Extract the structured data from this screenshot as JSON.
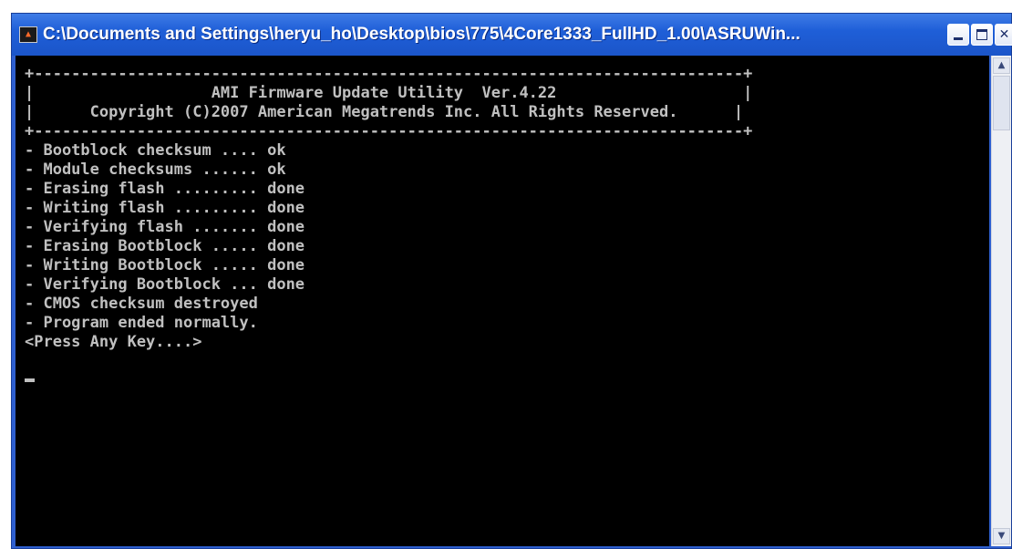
{
  "window": {
    "title": "C:\\Documents and Settings\\heryu_ho\\Desktop\\bios\\775\\4Core1333_FullHD_1.00\\ASRUWin...",
    "icon": "console-app-icon",
    "controls": {
      "minimize": "minimize-icon",
      "maximize": "maximize-icon",
      "close": "close-icon"
    }
  },
  "console": {
    "lines": [
      "+----------------------------------------------------------------------------+",
      "|                   AMI Firmware Update Utility  Ver.4.22                    |",
      "|      Copyright (C)2007 American Megatrends Inc. All Rights Reserved.      |",
      "+----------------------------------------------------------------------------+",
      "- Bootblock checksum .... ok",
      "- Module checksums ...... ok",
      "- Erasing flash ......... done",
      "- Writing flash ......... done",
      "- Verifying flash ....... done",
      "- Erasing Bootblock ..... done",
      "- Writing Bootblock ..... done",
      "- Verifying Bootblock ... done",
      "- CMOS checksum destroyed",
      "- Program ended normally.",
      "<Press Any Key....>"
    ]
  },
  "colors": {
    "titlebar": "#1f5fd8",
    "console_bg": "#000000",
    "console_fg": "#c0c0c0"
  }
}
